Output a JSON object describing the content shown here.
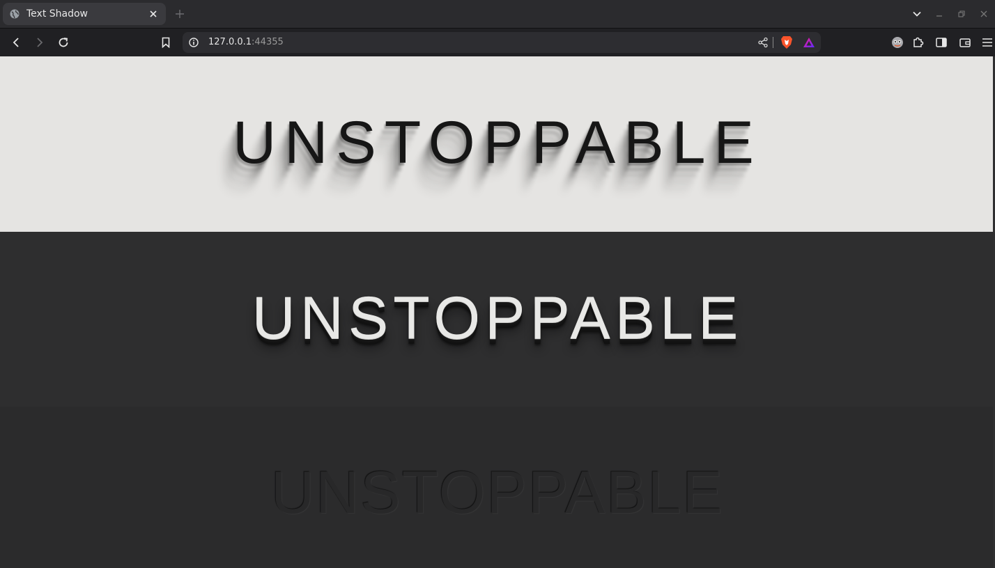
{
  "browser": {
    "tab": {
      "title": "Text Shadow",
      "favicon_icon": "globe-icon",
      "close_icon": "close-icon"
    },
    "new_tab_icon": "plus-icon",
    "tab_search_icon": "chevron-down-icon",
    "window_controls": [
      "minimize-icon",
      "restore-icon",
      "close-window-icon"
    ]
  },
  "toolbar": {
    "back_icon": "back-arrow-icon",
    "forward_icon": "forward-arrow-icon",
    "reload_icon": "reload-icon",
    "bookmark_icon": "bookmark-icon",
    "url_host": "127.0.0.1",
    "url_port": ":44355",
    "site_info_icon": "info-icon",
    "share_icon": "share-icon",
    "brave_shields_icon": "brave-lion-icon",
    "brave_rewards_icon": "rewards-triangle-icon",
    "extensions": [
      "extension-avatar-icon",
      "puzzle-icon",
      "sidebar-icon",
      "wallet-icon",
      "menu-icon"
    ]
  },
  "content": {
    "panels": [
      {
        "text": "UNSTOPPABLE",
        "background": "#e5e4e2",
        "color": "#161616"
      },
      {
        "text": "UNSTOPPABLE",
        "background": "#2e2e2f",
        "color": "#e8e8e6"
      },
      {
        "text": "UNSTOPPABLE",
        "background": "#2b2b2c",
        "color": "#282829"
      }
    ]
  },
  "colors": {
    "tab_strip": "#2b2b2e",
    "toolbar": "#202023",
    "omnibox": "#2d2d31",
    "brave_orange": "#fb542b"
  }
}
